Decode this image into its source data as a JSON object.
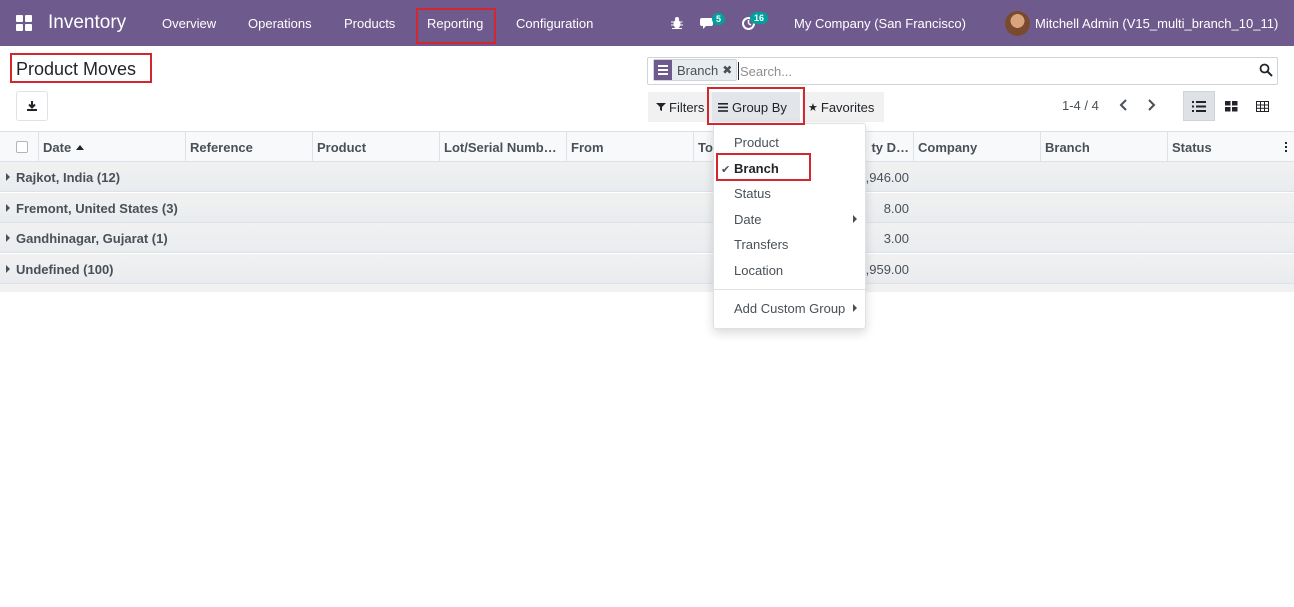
{
  "navbar": {
    "brand": "Inventory",
    "menu": [
      "Overview",
      "Operations",
      "Products",
      "Reporting",
      "Configuration"
    ],
    "messages_badge": "5",
    "activities_badge": "16",
    "company": "My Company (San Francisco)",
    "user": "Mitchell Admin (V15_multi_branch_10_11)"
  },
  "control_panel": {
    "title": "Product Moves",
    "search_facet": "Branch",
    "search_placeholder": "Search...",
    "filters_label": "Filters",
    "groupby_label": "Group By",
    "favorites_label": "Favorites",
    "pager": "1-4 / 4"
  },
  "table": {
    "columns": [
      "Date",
      "Reference",
      "Product",
      "Lot/Serial Numb…",
      "From",
      "To",
      "ty D…",
      "Company",
      "Branch",
      "Status"
    ],
    "groups": [
      {
        "label": "Rajkot, India (12)",
        "value": ",946.00"
      },
      {
        "label": "Fremont, United States (3)",
        "value": "8.00"
      },
      {
        "label": "Gandhinagar, Gujarat (1)",
        "value": "3.00"
      },
      {
        "label": "Undefined (100)",
        "value": ",959.00"
      }
    ]
  },
  "groupby_dropdown": {
    "items": [
      "Product",
      "Branch",
      "Status",
      "Date",
      "Transfers",
      "Location"
    ],
    "custom": "Add Custom Group"
  },
  "colors": {
    "navbar": "#6f5a8e",
    "highlight": "#d2272d",
    "badge": "#00a09d"
  }
}
